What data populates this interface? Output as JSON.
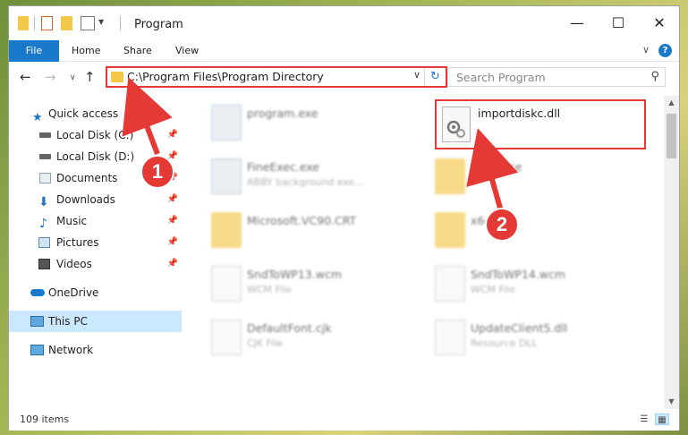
{
  "window": {
    "title": "Program",
    "tabs": [
      {
        "label": "File"
      },
      {
        "label": "Home"
      },
      {
        "label": "Share"
      },
      {
        "label": "View"
      }
    ],
    "help": "?"
  },
  "nav": {
    "address": "C:\\Program Files\\Program Directory",
    "search_placeholder": "Search Program"
  },
  "sidebar": {
    "items": [
      {
        "label": "Quick access"
      },
      {
        "label": "Local Disk (C:)"
      },
      {
        "label": "Local Disk (D:)"
      },
      {
        "label": "Documents"
      },
      {
        "label": "Downloads"
      },
      {
        "label": "Music"
      },
      {
        "label": "Pictures"
      },
      {
        "label": "Videos"
      },
      {
        "label": "OneDrive"
      },
      {
        "label": "This PC"
      },
      {
        "label": "Network"
      }
    ]
  },
  "files": [
    {
      "name": "program.exe",
      "desc": ""
    },
    {
      "name": "FineExec.exe",
      "desc": "ABBY background exe..."
    },
    {
      "name": "Resource",
      "desc": ""
    },
    {
      "name": "Microsoft.VC90.CRT",
      "desc": ""
    },
    {
      "name": "x64",
      "desc": ""
    },
    {
      "name": "SndToWP13.wcm",
      "desc": "WCM File"
    },
    {
      "name": "SndToWP14.wcm",
      "desc": "WCM File"
    },
    {
      "name": "DefaultFont.cjk",
      "desc": "CJK File"
    },
    {
      "name": "UpdateClient5.dll",
      "desc": "Resource DLL"
    }
  ],
  "target_file": {
    "name": "importdiskc.dll"
  },
  "status": {
    "count": "109 items"
  },
  "annotations": {
    "step1": "1",
    "step2": "2"
  },
  "colors": {
    "accent": "#1979ca",
    "highlight": "#e53935"
  }
}
